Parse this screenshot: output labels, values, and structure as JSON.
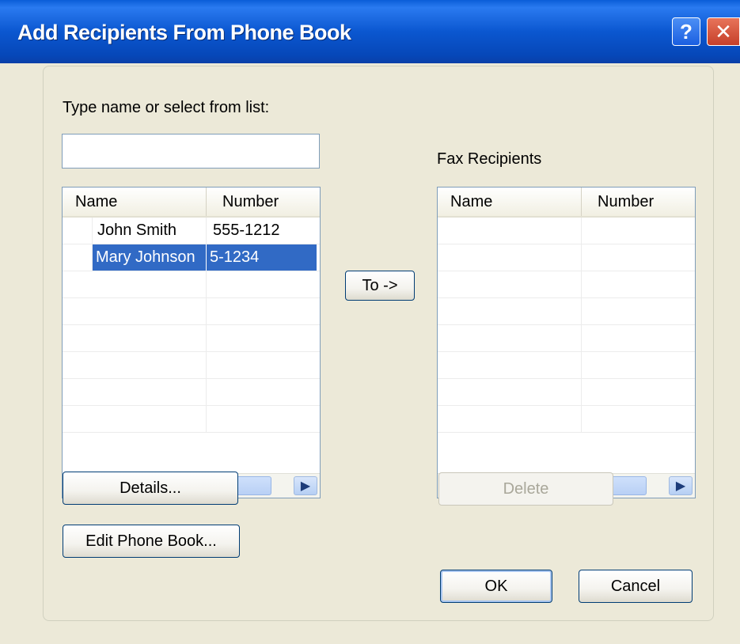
{
  "window": {
    "title": "Add Recipients From Phone Book",
    "help_label": "?",
    "close_label": "✕"
  },
  "phonebook": {
    "prompt": "Type name or select from list:",
    "search_value": "",
    "columns": [
      "Name",
      "Number"
    ],
    "rows": [
      {
        "name": "John Smith",
        "number": "555-1212",
        "selected": false
      },
      {
        "name": "Mary Johnson",
        "number": "5-1234",
        "selected": true
      }
    ],
    "details_label": "Details...",
    "edit_label": "Edit Phone Book..."
  },
  "to_button": {
    "label": "To ->"
  },
  "recipients": {
    "title": "Fax Recipients",
    "columns": [
      "Name",
      "Number"
    ],
    "rows": [],
    "delete_label": "Delete"
  },
  "footer": {
    "ok_label": "OK",
    "cancel_label": "Cancel"
  },
  "colors": {
    "title_bar": "#0b57d0",
    "dialog_bg": "#ece9d8",
    "selection": "#316ac5"
  }
}
